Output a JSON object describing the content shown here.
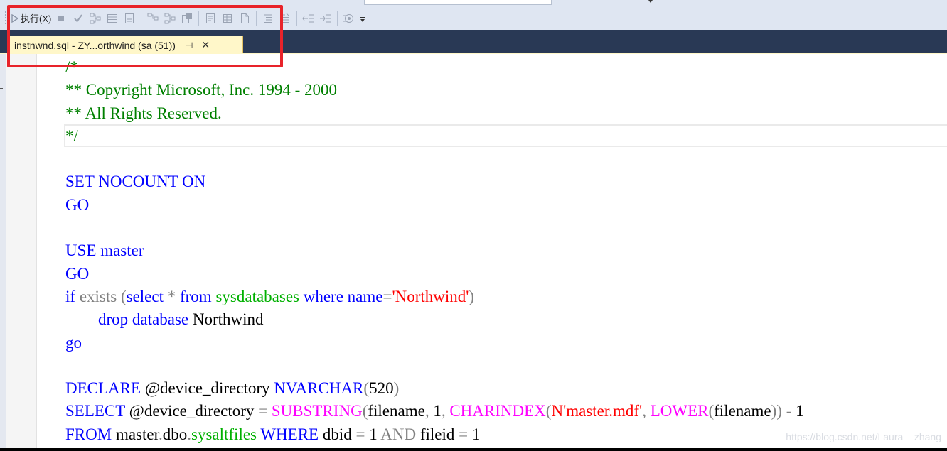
{
  "toolbar": {
    "execute_label": "执行(X)"
  },
  "document_tab": {
    "title": "instnwnd.sql - ZY...orthwind (sa (51))",
    "pin_icon": "⊣",
    "close_icon": "✕"
  },
  "editor": {
    "lines": [
      {
        "tokens": [
          {
            "t": "/*",
            "c": "cm"
          }
        ]
      },
      {
        "tokens": [
          {
            "t": "** Copyright Microsoft, Inc. 1994 - 2000",
            "c": "cm"
          }
        ]
      },
      {
        "tokens": [
          {
            "t": "** All Rights Reserved.",
            "c": "cm"
          }
        ]
      },
      {
        "tokens": [
          {
            "t": "*/",
            "c": "cm"
          }
        ]
      },
      {
        "tokens": []
      },
      {
        "tokens": [
          {
            "t": "SET NOCOUNT ON",
            "c": "kw"
          }
        ]
      },
      {
        "tokens": [
          {
            "t": "GO",
            "c": "kw"
          }
        ]
      },
      {
        "tokens": []
      },
      {
        "tokens": [
          {
            "t": "USE",
            "c": "kw"
          },
          {
            "t": " master",
            "c": "kw"
          }
        ]
      },
      {
        "tokens": [
          {
            "t": "GO",
            "c": "kw"
          }
        ]
      },
      {
        "tokens": [
          {
            "t": "if",
            "c": "kw"
          },
          {
            "t": " exists (",
            "c": "gr"
          },
          {
            "t": "select",
            "c": "kw"
          },
          {
            "t": " * ",
            "c": "gr"
          },
          {
            "t": "from",
            "c": "kw"
          },
          {
            "t": " ",
            "c": ""
          },
          {
            "t": "sysdatabases",
            "c": "sy"
          },
          {
            "t": " ",
            "c": ""
          },
          {
            "t": "where",
            "c": "kw"
          },
          {
            "t": " ",
            "c": ""
          },
          {
            "t": "name",
            "c": "kw"
          },
          {
            "t": "=",
            "c": "gr"
          },
          {
            "t": "'Northwind'",
            "c": "st"
          },
          {
            "t": ")",
            "c": "gr"
          }
        ]
      },
      {
        "tokens": [
          {
            "t": "        ",
            "c": ""
          },
          {
            "t": "drop",
            "c": "kw"
          },
          {
            "t": " ",
            "c": ""
          },
          {
            "t": "database",
            "c": "kw"
          },
          {
            "t": " Northwind",
            "c": ""
          }
        ]
      },
      {
        "tokens": [
          {
            "t": "go",
            "c": "kw"
          }
        ]
      },
      {
        "tokens": []
      },
      {
        "tokens": [
          {
            "t": "DECLARE",
            "c": "kw"
          },
          {
            "t": " @device_directory ",
            "c": ""
          },
          {
            "t": "NVARCHAR",
            "c": "kw"
          },
          {
            "t": "(",
            "c": "gr"
          },
          {
            "t": "520",
            "c": ""
          },
          {
            "t": ")",
            "c": "gr"
          }
        ]
      },
      {
        "tokens": [
          {
            "t": "SELECT",
            "c": "kw"
          },
          {
            "t": " @device_directory ",
            "c": ""
          },
          {
            "t": "=",
            "c": "gr"
          },
          {
            "t": " ",
            "c": ""
          },
          {
            "t": "SUBSTRING",
            "c": "fn"
          },
          {
            "t": "(",
            "c": "gr"
          },
          {
            "t": "filename",
            "c": ""
          },
          {
            "t": ",",
            "c": "gr"
          },
          {
            "t": " 1",
            "c": ""
          },
          {
            "t": ",",
            "c": "gr"
          },
          {
            "t": " ",
            "c": ""
          },
          {
            "t": "CHARINDEX",
            "c": "fn"
          },
          {
            "t": "(",
            "c": "gr"
          },
          {
            "t": "N'master.mdf'",
            "c": "st"
          },
          {
            "t": ",",
            "c": "gr"
          },
          {
            "t": " ",
            "c": ""
          },
          {
            "t": "LOWER",
            "c": "fn"
          },
          {
            "t": "(",
            "c": "gr"
          },
          {
            "t": "filename",
            "c": ""
          },
          {
            "t": "))",
            "c": "gr"
          },
          {
            "t": " - ",
            "c": "gr"
          },
          {
            "t": "1",
            "c": ""
          }
        ]
      },
      {
        "tokens": [
          {
            "t": "FROM",
            "c": "kw"
          },
          {
            "t": " master",
            "c": ""
          },
          {
            "t": ".",
            "c": "gr"
          },
          {
            "t": "dbo",
            "c": ""
          },
          {
            "t": ".",
            "c": "gr"
          },
          {
            "t": "sysaltfiles",
            "c": "sy"
          },
          {
            "t": " ",
            "c": ""
          },
          {
            "t": "WHERE",
            "c": "kw"
          },
          {
            "t": " dbid ",
            "c": ""
          },
          {
            "t": "=",
            "c": "gr"
          },
          {
            "t": " 1 ",
            "c": ""
          },
          {
            "t": "AND",
            "c": "gr"
          },
          {
            "t": " fileid ",
            "c": ""
          },
          {
            "t": "=",
            "c": "gr"
          },
          {
            "t": " 1",
            "c": ""
          }
        ]
      }
    ]
  },
  "watermark": "https://blog.csdn.net/Laura__zhang"
}
